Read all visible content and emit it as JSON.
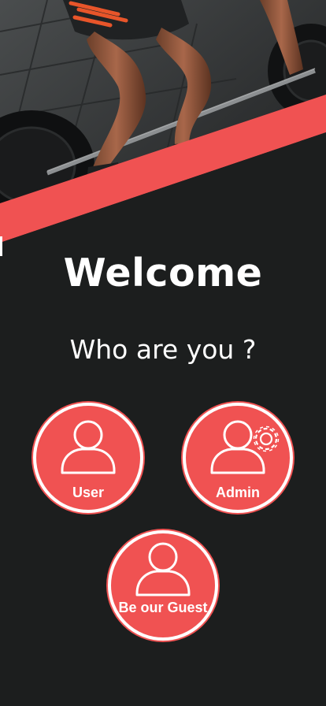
{
  "hero": {
    "image": "athlete-barbell-deadlift-photo"
  },
  "welcome": {
    "title": "Welcome",
    "subtitle": "Who are you ?"
  },
  "roles": {
    "user": {
      "label": "User",
      "icon": "person-icon"
    },
    "admin": {
      "label": "Admin",
      "icon": "person-gear-icon"
    },
    "guest": {
      "label": "Be our Guest",
      "icon": "person-icon"
    }
  },
  "colors": {
    "background": "#1c1e1e",
    "accent": "#f05252",
    "text": "#ffffff"
  }
}
